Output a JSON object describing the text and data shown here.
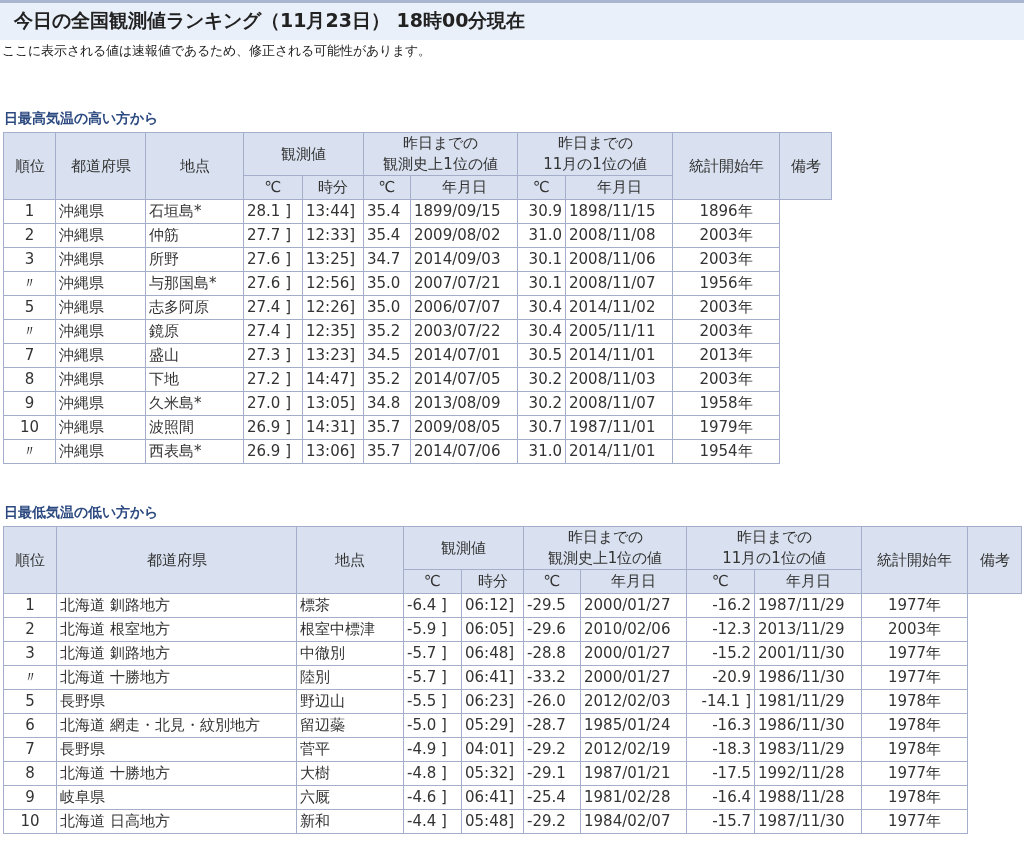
{
  "title": "今日の全国観測値ランキング（11月23日） 18時00分現在",
  "notice": "ここに表示される値は速報値であるため、修正される可能性があります。",
  "sections": [
    {
      "heading": "日最高気温の高い方から",
      "header_top": [
        [
          "順位"
        ],
        [
          "都道府県"
        ],
        [
          "地点"
        ],
        [
          "観測値"
        ],
        [
          "昨日までの",
          "観測史上1位の値"
        ],
        [
          "昨日までの",
          "11月の1位の値"
        ],
        [
          "統計開始年"
        ],
        [
          "備考"
        ]
      ],
      "header_sub": [
        "℃",
        "時分",
        "℃",
        "年月日",
        "℃",
        "年月日"
      ],
      "rows": [
        [
          "1",
          "沖縄県",
          "石垣島*",
          "28.1 ]",
          "13:44]",
          "35.4",
          "1899/09/15",
          "30.9",
          "1898/11/15",
          "1896年"
        ],
        [
          "2",
          "沖縄県",
          "仲筋",
          "27.7 ]",
          "12:33]",
          "35.4",
          "2009/08/02",
          "31.0",
          "2008/11/08",
          "2003年"
        ],
        [
          "3",
          "沖縄県",
          "所野",
          "27.6 ]",
          "13:25]",
          "34.7",
          "2014/09/03",
          "30.1",
          "2008/11/06",
          "2003年"
        ],
        [
          "〃",
          "沖縄県",
          "与那国島*",
          "27.6 ]",
          "12:56]",
          "35.0",
          "2007/07/21",
          "30.1",
          "2008/11/07",
          "1956年"
        ],
        [
          "5",
          "沖縄県",
          "志多阿原",
          "27.4 ]",
          "12:26]",
          "35.0",
          "2006/07/07",
          "30.4",
          "2014/11/02",
          "2003年"
        ],
        [
          "〃",
          "沖縄県",
          "鏡原",
          "27.4 ]",
          "12:35]",
          "35.2",
          "2003/07/22",
          "30.4",
          "2005/11/11",
          "2003年"
        ],
        [
          "7",
          "沖縄県",
          "盛山",
          "27.3 ]",
          "13:23]",
          "34.5",
          "2014/07/01",
          "30.5",
          "2014/11/01",
          "2013年"
        ],
        [
          "8",
          "沖縄県",
          "下地",
          "27.2 ]",
          "14:47]",
          "35.2",
          "2014/07/05",
          "30.2",
          "2008/11/03",
          "2003年"
        ],
        [
          "9",
          "沖縄県",
          "久米島*",
          "27.0 ]",
          "13:05]",
          "34.8",
          "2013/08/09",
          "30.2",
          "2008/11/07",
          "1958年"
        ],
        [
          "10",
          "沖縄県",
          "波照間",
          "26.9 ]",
          "14:31]",
          "35.7",
          "2009/08/05",
          "30.7",
          "1987/11/01",
          "1979年"
        ],
        [
          "〃",
          "沖縄県",
          "西表島*",
          "26.9 ]",
          "13:06]",
          "35.7",
          "2014/07/06",
          "31.0",
          "2014/11/01",
          "1954年"
        ]
      ]
    },
    {
      "heading": "日最低気温の低い方から",
      "header_top": [
        [
          "順位"
        ],
        [
          "都道府県"
        ],
        [
          "地点"
        ],
        [
          "観測値"
        ],
        [
          "昨日までの",
          "観測史上1位の値"
        ],
        [
          "昨日までの",
          "11月の1位の値"
        ],
        [
          "統計開始年"
        ],
        [
          "備考"
        ]
      ],
      "header_sub": [
        "℃",
        "時分",
        "℃",
        "年月日",
        "℃",
        "年月日"
      ],
      "rows": [
        [
          "1",
          "北海道 釧路地方",
          "標茶",
          "-6.4 ]",
          "06:12]",
          "-29.5",
          "2000/01/27",
          "-16.2",
          "1987/11/29",
          "1977年"
        ],
        [
          "2",
          "北海道 根室地方",
          "根室中標津",
          "-5.9 ]",
          "06:05]",
          "-29.6",
          "2010/02/06",
          "-12.3",
          "2013/11/29",
          "2003年"
        ],
        [
          "3",
          "北海道 釧路地方",
          "中徹別",
          "-5.7 ]",
          "06:48]",
          "-28.8",
          "2000/01/27",
          "-15.2",
          "2001/11/30",
          "1977年"
        ],
        [
          "〃",
          "北海道 十勝地方",
          "陸別",
          "-5.7 ]",
          "06:41]",
          "-33.2",
          "2000/01/27",
          "-20.9",
          "1986/11/30",
          "1977年"
        ],
        [
          "5",
          "長野県",
          "野辺山",
          "-5.5 ]",
          "06:23]",
          "-26.0",
          "2012/02/03",
          "-14.1 ]",
          "1981/11/29",
          "1978年"
        ],
        [
          "6",
          "北海道 網走・北見・紋別地方",
          "留辺蘂",
          "-5.0 ]",
          "05:29]",
          "-28.7",
          "1985/01/24",
          "-16.3",
          "1986/11/30",
          "1978年"
        ],
        [
          "7",
          "長野県",
          "菅平",
          "-4.9 ]",
          "04:01]",
          "-29.2",
          "2012/02/19",
          "-18.3",
          "1983/11/29",
          "1978年"
        ],
        [
          "8",
          "北海道 十勝地方",
          "大樹",
          "-4.8 ]",
          "05:32]",
          "-29.1",
          "1987/01/21",
          "-17.5",
          "1992/11/28",
          "1977年"
        ],
        [
          "9",
          "岐阜県",
          "六厩",
          "-4.6 ]",
          "06:41]",
          "-25.4",
          "1981/02/28",
          "-16.4",
          "1988/11/28",
          "1978年"
        ],
        [
          "10",
          "北海道 日高地方",
          "新和",
          "-4.4 ]",
          "05:48]",
          "-29.2",
          "1984/02/07",
          "-15.7",
          "1987/11/30",
          "1977年"
        ]
      ]
    }
  ]
}
